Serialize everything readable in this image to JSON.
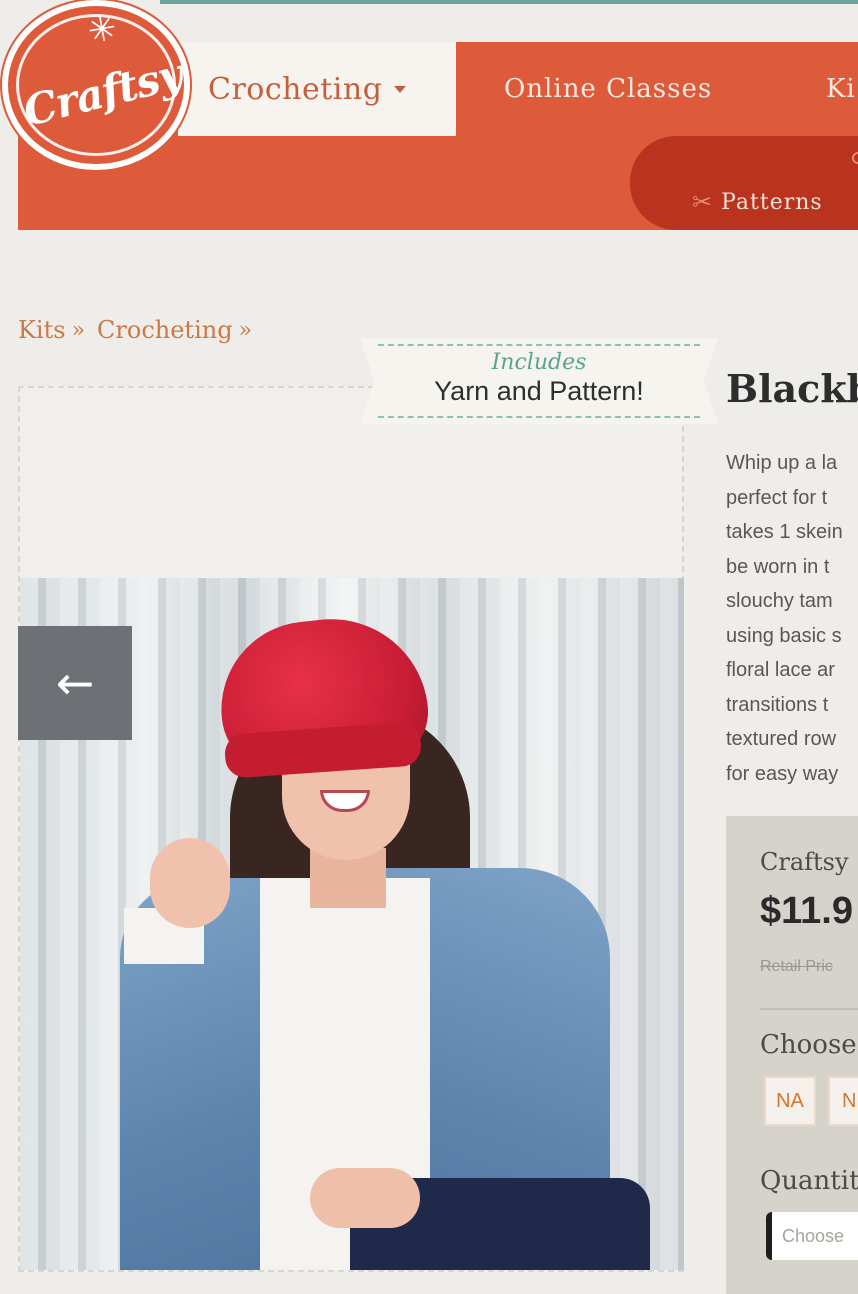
{
  "header": {
    "logo_text": "Craftsy",
    "category_label": "Crocheting",
    "nav": {
      "online_classes": "Online Classes",
      "kits": "Ki"
    },
    "sub_nav": {
      "patterns": "Patterns"
    },
    "colors": {
      "brand": "#dd5a3a",
      "sub_nav": "#b9331f"
    }
  },
  "breadcrumb": {
    "items": [
      "Kits",
      "Crocheting"
    ],
    "separator": "»"
  },
  "banner": {
    "subtitle": "Includes",
    "title": "Yarn and Pattern!"
  },
  "gallery": {
    "prev_icon": "arrow-left-icon",
    "prev_glyph": "←"
  },
  "product": {
    "title": "Blackb",
    "description_lines": [
      "Whip up a la",
      "perfect for t",
      "takes 1 skein",
      "be worn in t",
      "slouchy tam",
      "using basic s",
      "floral lace ar",
      "transitions t",
      "textured row",
      "for easy way"
    ]
  },
  "purchase": {
    "seller": "Craftsy",
    "price": "$11.9",
    "retail": "Retail Pric",
    "choose_label": "Choose",
    "options": [
      "NA",
      "N"
    ],
    "quantity_label": "Quantity",
    "quantity_placeholder": "Choose"
  }
}
